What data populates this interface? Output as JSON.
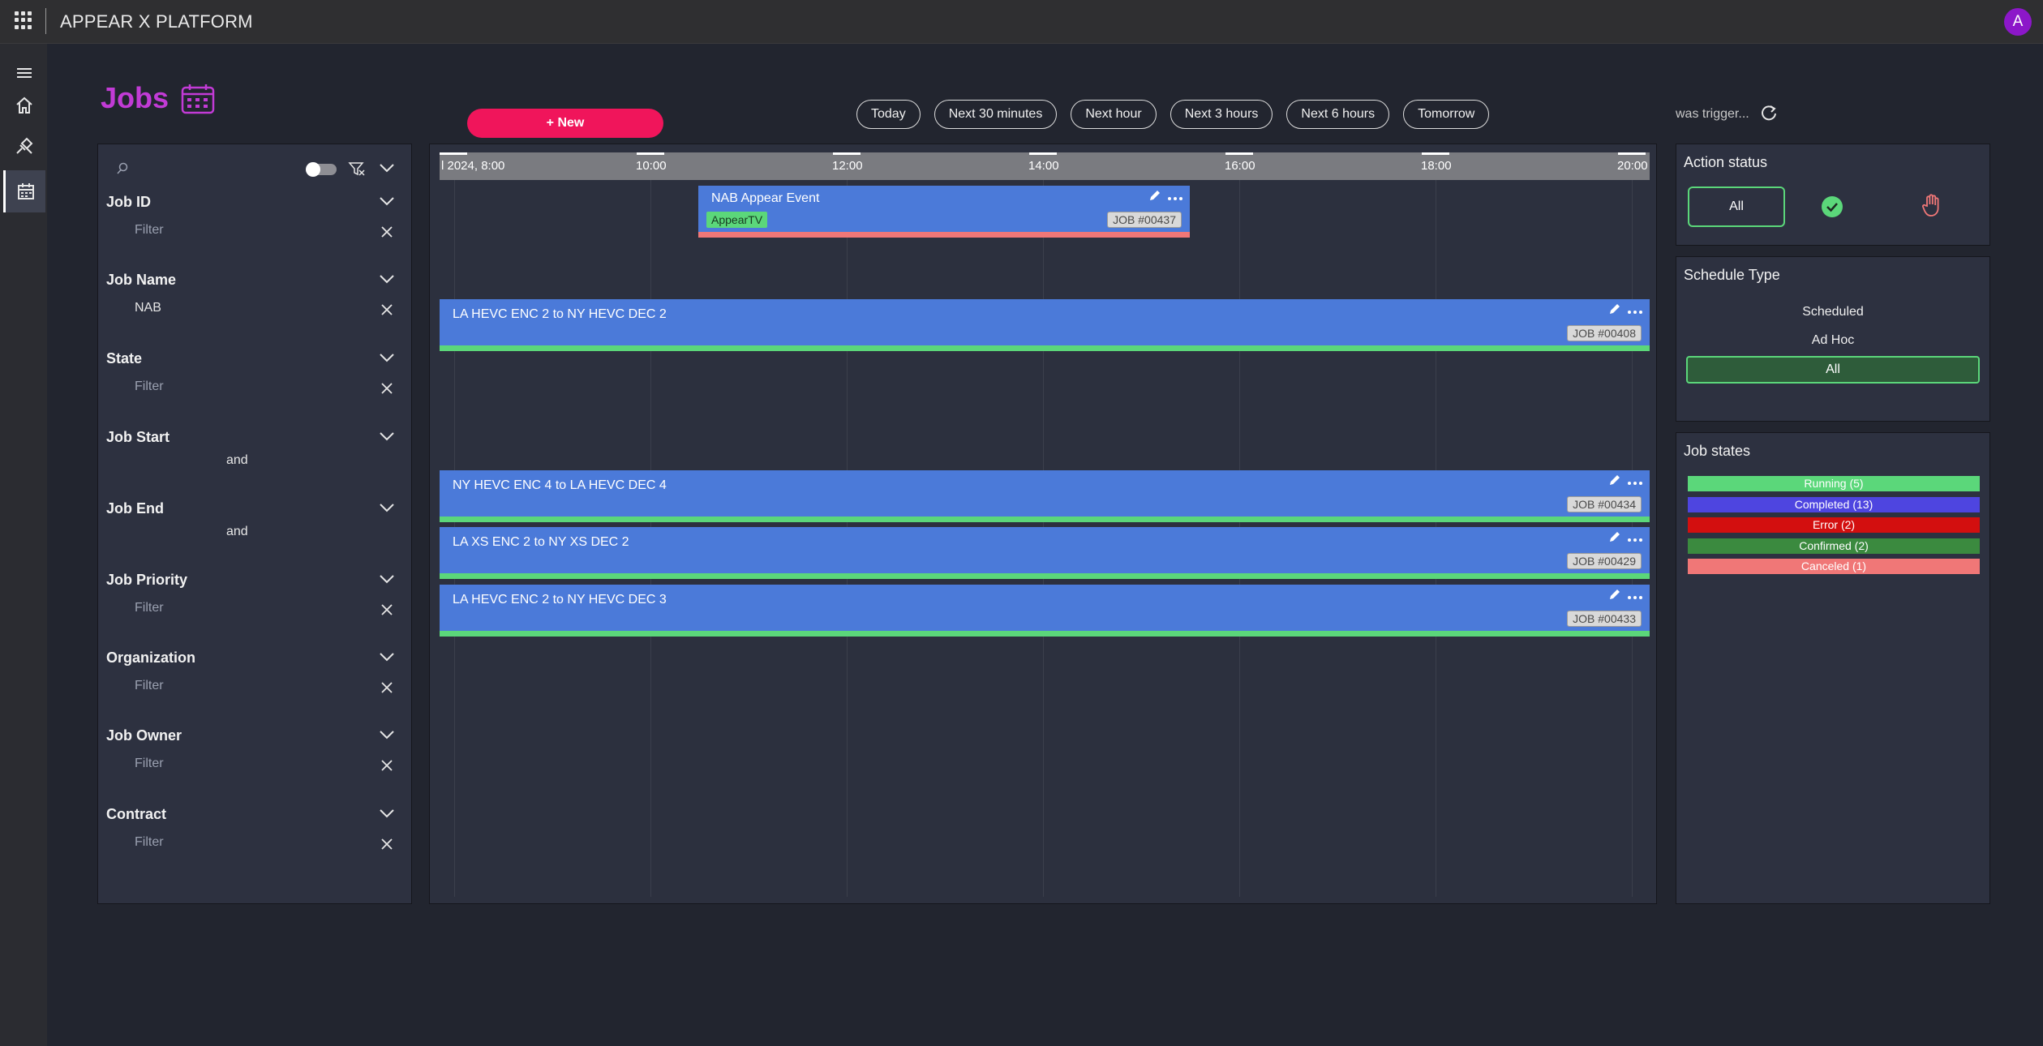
{
  "app": {
    "title": "APPEAR X PLATFORM",
    "avatar_letter": "A"
  },
  "nav": {
    "items": [
      "menu-icon",
      "home-icon",
      "connection-icon",
      "calendar-icon"
    ],
    "active": "calendar-icon"
  },
  "page": {
    "title": "Jobs",
    "new_label": "+ New"
  },
  "time_ranges": [
    "Today",
    "Next 30 minutes",
    "Next hour",
    "Next 3 hours",
    "Next 6 hours",
    "Tomorrow"
  ],
  "status_text": "was trigger...",
  "filters": {
    "search_placeholder": "",
    "groups": [
      {
        "label": "Job ID",
        "value": "",
        "placeholder": "Filter",
        "type": "text"
      },
      {
        "label": "Job Name",
        "value": "NAB",
        "placeholder": "Filter",
        "type": "text"
      },
      {
        "label": "State",
        "value": "",
        "placeholder": "Filter",
        "type": "text"
      },
      {
        "label": "Job Start",
        "and_label": "and",
        "type": "range"
      },
      {
        "label": "Job End",
        "and_label": "and",
        "type": "range"
      },
      {
        "label": "Job Priority",
        "value": "",
        "placeholder": "Filter",
        "type": "text"
      },
      {
        "label": "Organization",
        "value": "",
        "placeholder": "Filter",
        "type": "text"
      },
      {
        "label": "Job Owner",
        "value": "",
        "placeholder": "Filter",
        "type": "text"
      },
      {
        "label": "Contract",
        "value": "",
        "placeholder": "Filter",
        "type": "text"
      }
    ]
  },
  "timeline": {
    "ticks": [
      "l 2024, 8:00",
      "10:00",
      "12:00",
      "14:00",
      "16:00",
      "18:00",
      "20:00"
    ],
    "jobs": [
      {
        "name": "NAB Appear Event",
        "id": "JOB #00437",
        "tag": "AppearTV",
        "status_color": "#f07777"
      },
      {
        "name": "LA HEVC ENC 2 to NY HEVC DEC 2",
        "id": "JOB #00408",
        "tag": "",
        "status_color": "#5bd77a"
      },
      {
        "name": "NY HEVC ENC 4 to LA HEVC DEC 4",
        "id": "JOB #00434",
        "tag": "",
        "status_color": "#5bd77a"
      },
      {
        "name": "LA XS ENC 2 to NY XS DEC 2",
        "id": "JOB #00429",
        "tag": "",
        "status_color": "#5bd77a"
      },
      {
        "name": "LA HEVC ENC 2 to NY HEVC DEC 3",
        "id": "JOB #00433",
        "tag": "",
        "status_color": "#5bd77a"
      }
    ]
  },
  "action_status": {
    "title": "Action status",
    "all_label": "All",
    "icons": [
      "check-circle-icon",
      "hand-icon"
    ]
  },
  "schedule_type": {
    "title": "Schedule Type",
    "options": [
      "Scheduled",
      "Ad Hoc"
    ],
    "all_label": "All"
  },
  "job_states": {
    "title": "Job states",
    "items": [
      {
        "label": "Running (5)",
        "color": "#5bd77a"
      },
      {
        "label": "Completed (13)",
        "color": "#4e45e0"
      },
      {
        "label": "Error (2)",
        "color": "#d30f0f"
      },
      {
        "label": "Confirmed (2)",
        "color": "#3b8a3f"
      },
      {
        "label": "Canceled (1)",
        "color": "#f07777"
      }
    ]
  }
}
